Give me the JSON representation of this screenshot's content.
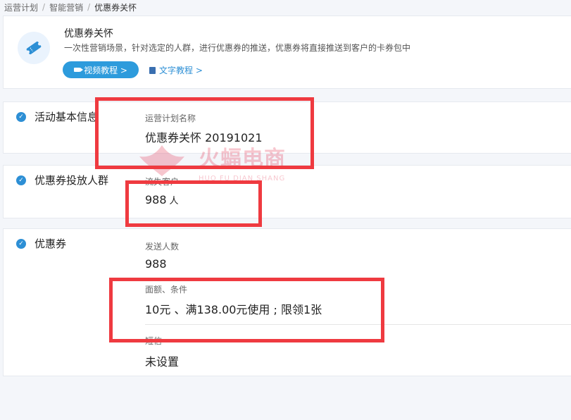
{
  "breadcrumb": {
    "items": [
      "运营计划",
      "智能营销",
      "优惠券关怀"
    ],
    "separator": "/"
  },
  "intro": {
    "icon": "ticket-icon",
    "title": "优惠券关怀",
    "description": "一次性营销场景，针对选定的人群，进行优惠券的推送，优惠券将直接推送到客户的卡券包中",
    "video_button": "视频教程 >",
    "text_link": "文字教程 >"
  },
  "sections": {
    "basic": {
      "title": "活动基本信息",
      "plan_name_label": "运营计划名称",
      "plan_name_value": "优惠券关怀 20191021"
    },
    "audience": {
      "title": "优惠券投放人群",
      "label": "流失客户",
      "count": "988",
      "unit": "人"
    },
    "coupon": {
      "title": "优惠券",
      "send_count_label": "发送人数",
      "send_count_value": "988",
      "face_label": "面额、条件",
      "face_value": "10元 、满138.00元使用 ; 限领1张",
      "sms_label": "短信",
      "sms_value": "未设置"
    }
  },
  "watermark": {
    "text": "火蝠电商",
    "sub": "HUO FU DIAN SHANG"
  },
  "colors": {
    "accent": "#2d8fd5",
    "highlight": "#ef3a40",
    "watermark": "#e53553"
  }
}
